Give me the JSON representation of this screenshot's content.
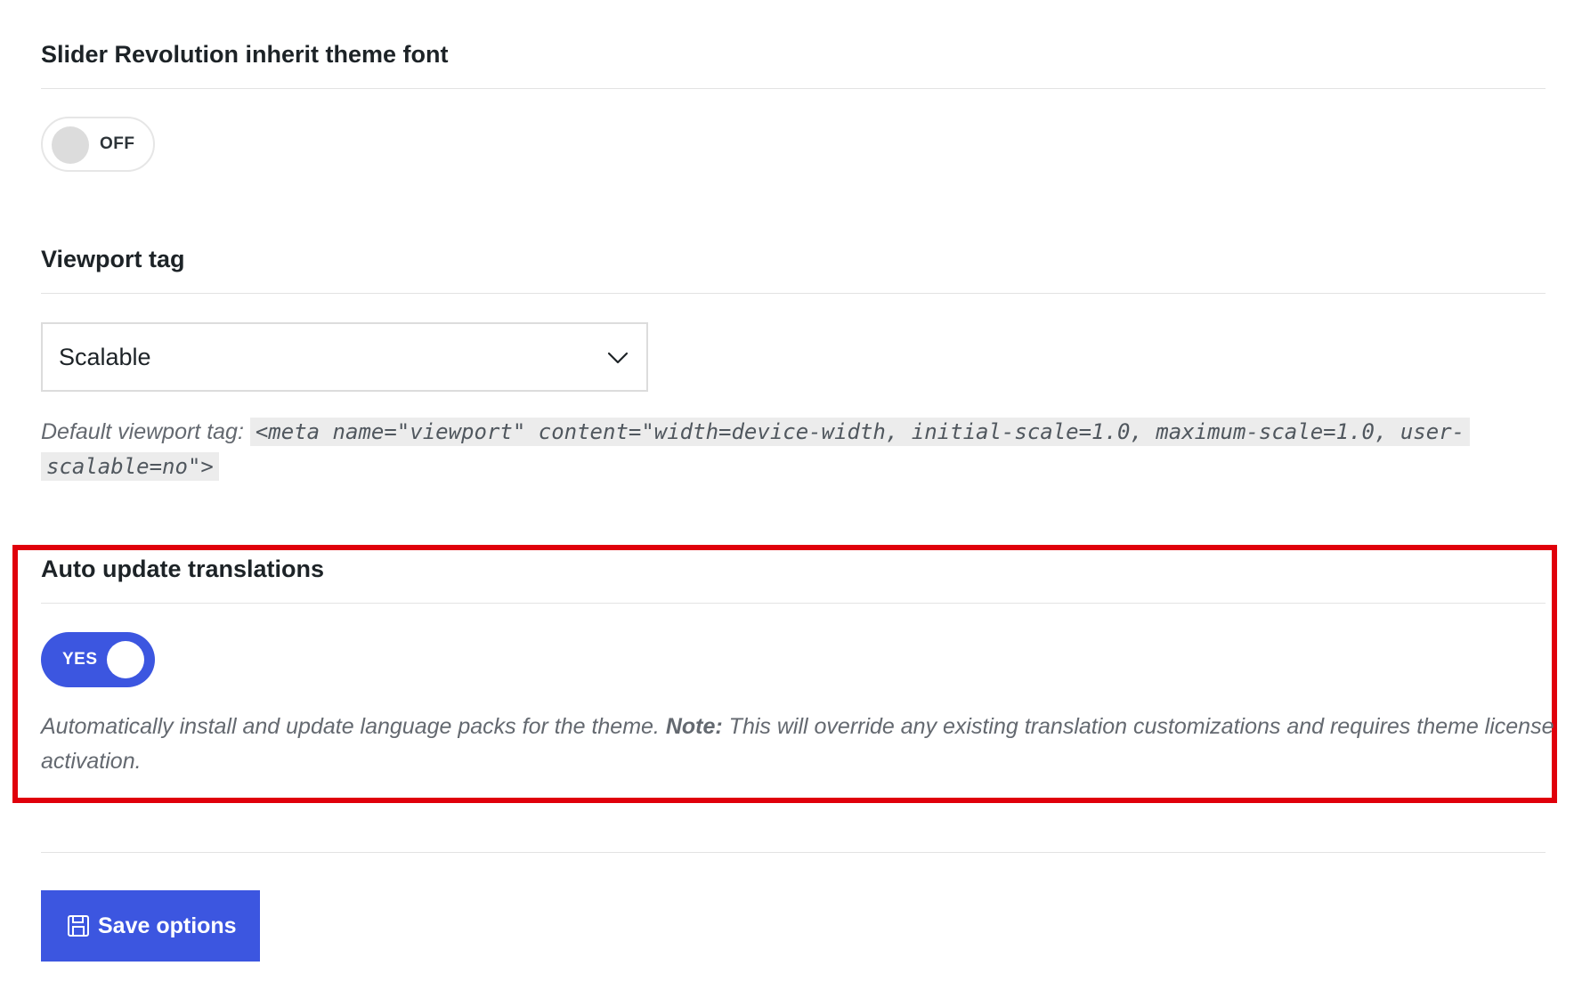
{
  "sections": {
    "theme_font": {
      "title": "Slider Revolution inherit theme font",
      "toggle_label": "OFF",
      "toggle_state": "off"
    },
    "viewport": {
      "title": "Viewport tag",
      "select_value": "Scalable",
      "description_prefix": "Default viewport tag:",
      "code": "<meta name=\"viewport\" content=\"width=device-width, initial-scale=1.0, maximum-scale=1.0, user-scalable=no\">"
    },
    "auto_update": {
      "title": "Auto update translations",
      "toggle_label": "YES",
      "toggle_state": "on",
      "description_start": "Automatically install and update language packs for the theme.",
      "note_label": "Note:",
      "description_end": "This will override any existing translation customizations and requires theme license activation."
    }
  },
  "footer": {
    "save_label": "Save options"
  },
  "colors": {
    "accent": "#3c56e0",
    "highlight_border": "#e0000b",
    "muted_text": "#646970"
  },
  "icons": {
    "select_chevron": "chevron-down-icon",
    "save": "floppy-disk-icon"
  }
}
